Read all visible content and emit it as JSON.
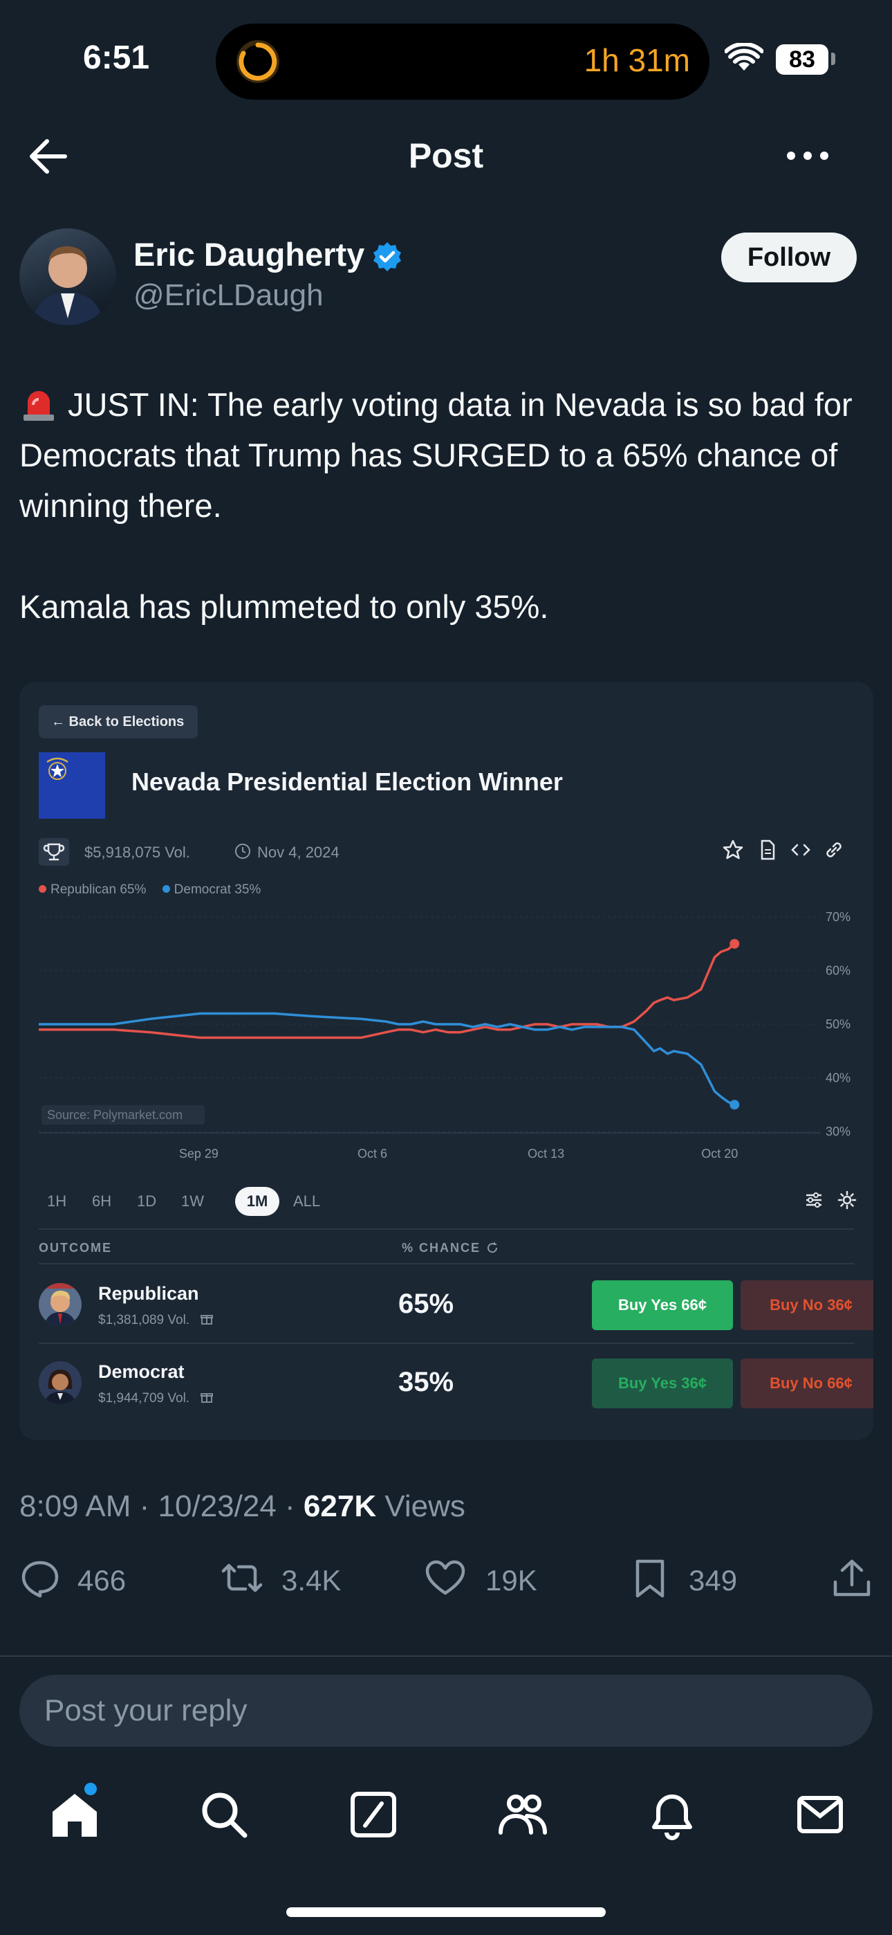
{
  "status_bar": {
    "time": "6:51",
    "timer": "1h 31m",
    "battery": "83"
  },
  "header": {
    "title": "Post"
  },
  "author": {
    "name": "Eric Daugherty",
    "handle": "@EricLDaugh",
    "follow_label": "Follow"
  },
  "tweet": {
    "line1": "JUST IN: The early voting data in Nevada is so bad for Democrats that Trump has SURGED to a 65% chance of winning there.",
    "line2": "Kamala has plummeted to only 35%."
  },
  "card": {
    "back_label": "← Back to Elections",
    "title": "Nevada Presidential Election Winner",
    "volume": "$5,918,075 Vol.",
    "date": "Nov 4, 2024",
    "legend": [
      "Republican 65%",
      "Democrat 35%"
    ],
    "source": "Source: Polymarket.com",
    "ranges": [
      "1H",
      "6H",
      "1D",
      "1W",
      "1M",
      "ALL"
    ],
    "active_range": "1M",
    "col_outcome": "OUTCOME",
    "col_chance": "% CHANCE",
    "outcomes": [
      {
        "name": "Republican",
        "volume": "$1,381,089 Vol.",
        "chance": "65%",
        "buy_yes": "Buy Yes 66¢",
        "buy_no": "Buy No 36¢"
      },
      {
        "name": "Democrat",
        "volume": "$1,944,709 Vol.",
        "chance": "35%",
        "buy_yes": "Buy Yes 36¢",
        "buy_no": "Buy No 66¢"
      }
    ],
    "colors": {
      "republican": "#e5534b",
      "democrat": "#2f8fd8",
      "buy_yes": "#27ae60",
      "buy_no_bg": "#4a2e34",
      "buy_no_text": "#e2522f"
    }
  },
  "chart_data": {
    "type": "line",
    "x_ticks": [
      "Sep 29",
      "Oct 6",
      "Oct 13",
      "Oct 20"
    ],
    "y_ticks": [
      "70%",
      "60%",
      "50%",
      "40%",
      "30%"
    ],
    "ylim": [
      30,
      70
    ],
    "series": [
      {
        "name": "Republican",
        "color": "#e5534b",
        "x": [
          0,
          6,
          9,
          13,
          19,
          22,
          26,
          28,
          29,
          30,
          31,
          32,
          33,
          34,
          35,
          36,
          37,
          38,
          39,
          40,
          41,
          42,
          43,
          44,
          45,
          46,
          47,
          48,
          49,
          49.6,
          50.1,
          50.7,
          51.2,
          52.3,
          53.4,
          54.5,
          55.0,
          55.6,
          56.1
        ],
        "y": [
          49.0,
          49.0,
          48.5,
          47.5,
          47.5,
          47.5,
          47.5,
          48.5,
          49.0,
          49.0,
          48.5,
          49.0,
          48.5,
          48.5,
          49.0,
          49.5,
          49.0,
          49.0,
          49.5,
          50.0,
          50.0,
          49.5,
          50.0,
          50.0,
          50.0,
          49.5,
          49.5,
          50.5,
          52.5,
          54.0,
          54.5,
          55.0,
          54.5,
          55.0,
          56.5,
          62.5,
          63.5,
          64.0,
          65.0
        ]
      },
      {
        "name": "Democrat",
        "color": "#2f8fd8",
        "x": [
          0,
          6,
          9,
          13,
          19,
          22,
          26,
          28,
          29,
          30,
          31,
          32,
          33,
          34,
          35,
          36,
          37,
          38,
          39,
          40,
          41,
          42,
          43,
          44,
          45,
          46,
          47,
          48,
          49,
          49.6,
          50.1,
          50.7,
          51.2,
          52.3,
          53.4,
          54.5,
          55.0,
          55.6,
          56.1
        ],
        "y": [
          50.0,
          50.0,
          51.0,
          52.0,
          52.0,
          51.5,
          51.0,
          50.5,
          50.0,
          50.0,
          50.5,
          50.0,
          50.0,
          50.0,
          49.5,
          50.0,
          49.5,
          50.0,
          49.5,
          49.0,
          49.0,
          49.5,
          49.0,
          49.5,
          49.5,
          49.5,
          49.5,
          49.0,
          46.5,
          45.0,
          45.5,
          44.5,
          45.0,
          44.5,
          42.5,
          37.5,
          36.5,
          35.5,
          35.0
        ]
      }
    ]
  },
  "post_meta": {
    "time": "8:09 AM · 10/23/24 · ",
    "views_count": "627K",
    "views_label": "Views"
  },
  "actions": {
    "replies": "466",
    "reposts": "3.4K",
    "likes": "19K",
    "bookmarks": "349"
  },
  "reply": {
    "placeholder": "Post your reply"
  }
}
